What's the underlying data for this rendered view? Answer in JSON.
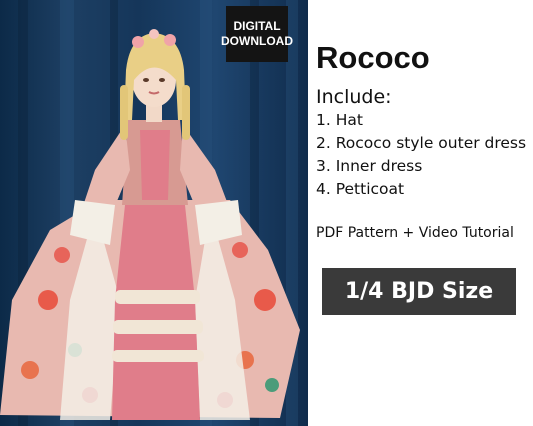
{
  "badge": {
    "line1": "DIGITAL",
    "line2": "DOWNLOAD"
  },
  "title": "Rococo",
  "include_heading": "Include:",
  "items": [
    "1. Hat",
    "2. Rococo style outer dress",
    "3. Inner dress",
    "4. Petticoat"
  ],
  "tagline": "PDF Pattern + Video Tutorial",
  "size_label": "1/4 BJD Size",
  "colors": {
    "backdrop": "#15365a",
    "dress_floral": "#e8b9b0",
    "inner_dress": "#e07d8a",
    "lace": "#f3efe6",
    "badge_bg": "#141414",
    "size_bg": "#3a3a3a"
  }
}
